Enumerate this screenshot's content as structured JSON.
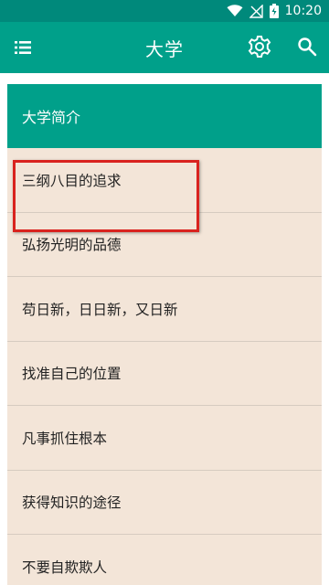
{
  "status_bar": {
    "time": "10:20",
    "icons": [
      "wifi-icon",
      "signal-off-icon",
      "battery-charging-icon"
    ]
  },
  "app_bar": {
    "title": "大学",
    "left_icon": "menu-icon",
    "right_icons": [
      "gear-icon",
      "search-icon"
    ]
  },
  "section_header": "大学简介",
  "list": [
    {
      "label": "三纲八目的追求"
    },
    {
      "label": "弘扬光明的品德"
    },
    {
      "label": "苟日新，日日新，又日新"
    },
    {
      "label": "找准自己的位置"
    },
    {
      "label": "凡事抓住根本"
    },
    {
      "label": "获得知识的途径"
    },
    {
      "label": "不要自欺欺人"
    }
  ],
  "colors": {
    "primary": "#00a08a",
    "status_bar": "#00897b",
    "list_bg": "#f3e5d8",
    "highlight": "#d9231f"
  }
}
